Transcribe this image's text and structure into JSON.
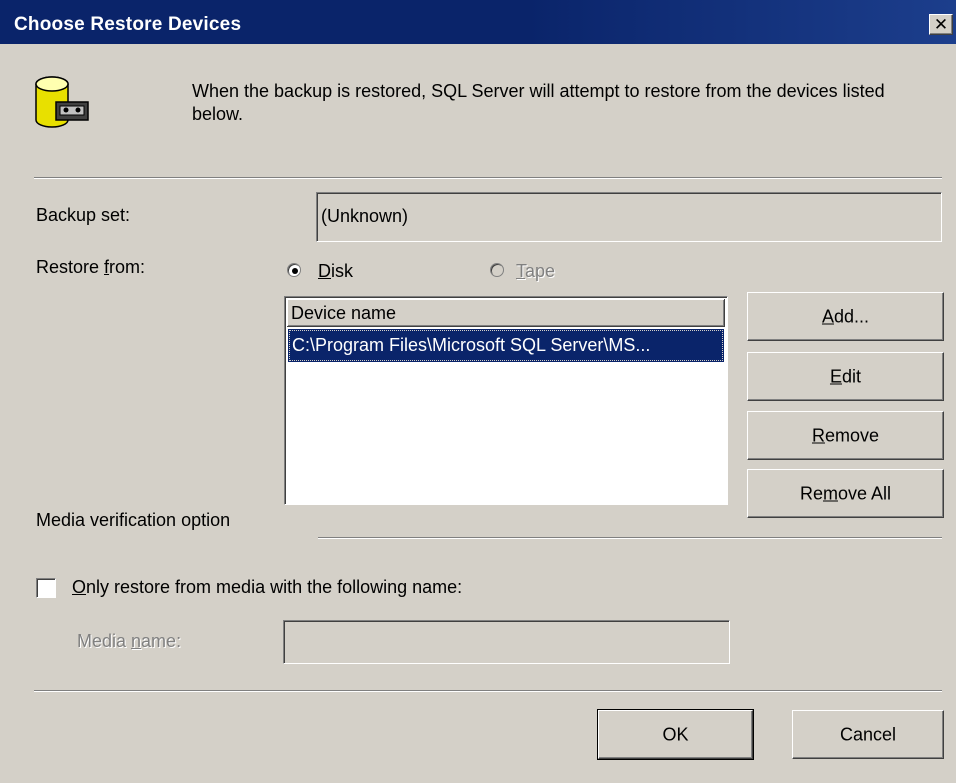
{
  "window": {
    "title": "Choose Restore Devices",
    "close_glyph": "✕"
  },
  "intro": {
    "icon": "database-tape-icon",
    "text": "When the backup is restored, SQL Server will attempt to restore from the devices listed below."
  },
  "backup_set": {
    "label": "Backup set:",
    "value": "(Unknown)"
  },
  "restore_from": {
    "label_pre": "Restore ",
    "label_accel": "f",
    "label_post": "rom:",
    "options": [
      {
        "accel": "D",
        "rest": "isk",
        "selected": true,
        "enabled": true
      },
      {
        "accel": "T",
        "rest": "ape",
        "selected": false,
        "enabled": false
      }
    ]
  },
  "device_list": {
    "column_header": "Device name",
    "rows": [
      "C:\\Program Files\\Microsoft SQL Server\\MS..."
    ],
    "selected_index": 0
  },
  "buttons": {
    "add": {
      "accel": "A",
      "rest": "dd..."
    },
    "edit": {
      "accel": "E",
      "rest": "dit"
    },
    "remove": {
      "accel": "R",
      "rest": "emove"
    },
    "remove_all_pre": "Re",
    "remove_all_accel": "m",
    "remove_all_post": "ove All",
    "ok": "OK",
    "cancel": "Cancel"
  },
  "media_verification": {
    "group_label": "Media verification option",
    "checkbox_accel": "O",
    "checkbox_rest": "nly restore from media with the following name:",
    "checked": false,
    "media_name_pre": "Media ",
    "media_name_accel": "n",
    "media_name_post": "ame:",
    "media_name_value": ""
  }
}
